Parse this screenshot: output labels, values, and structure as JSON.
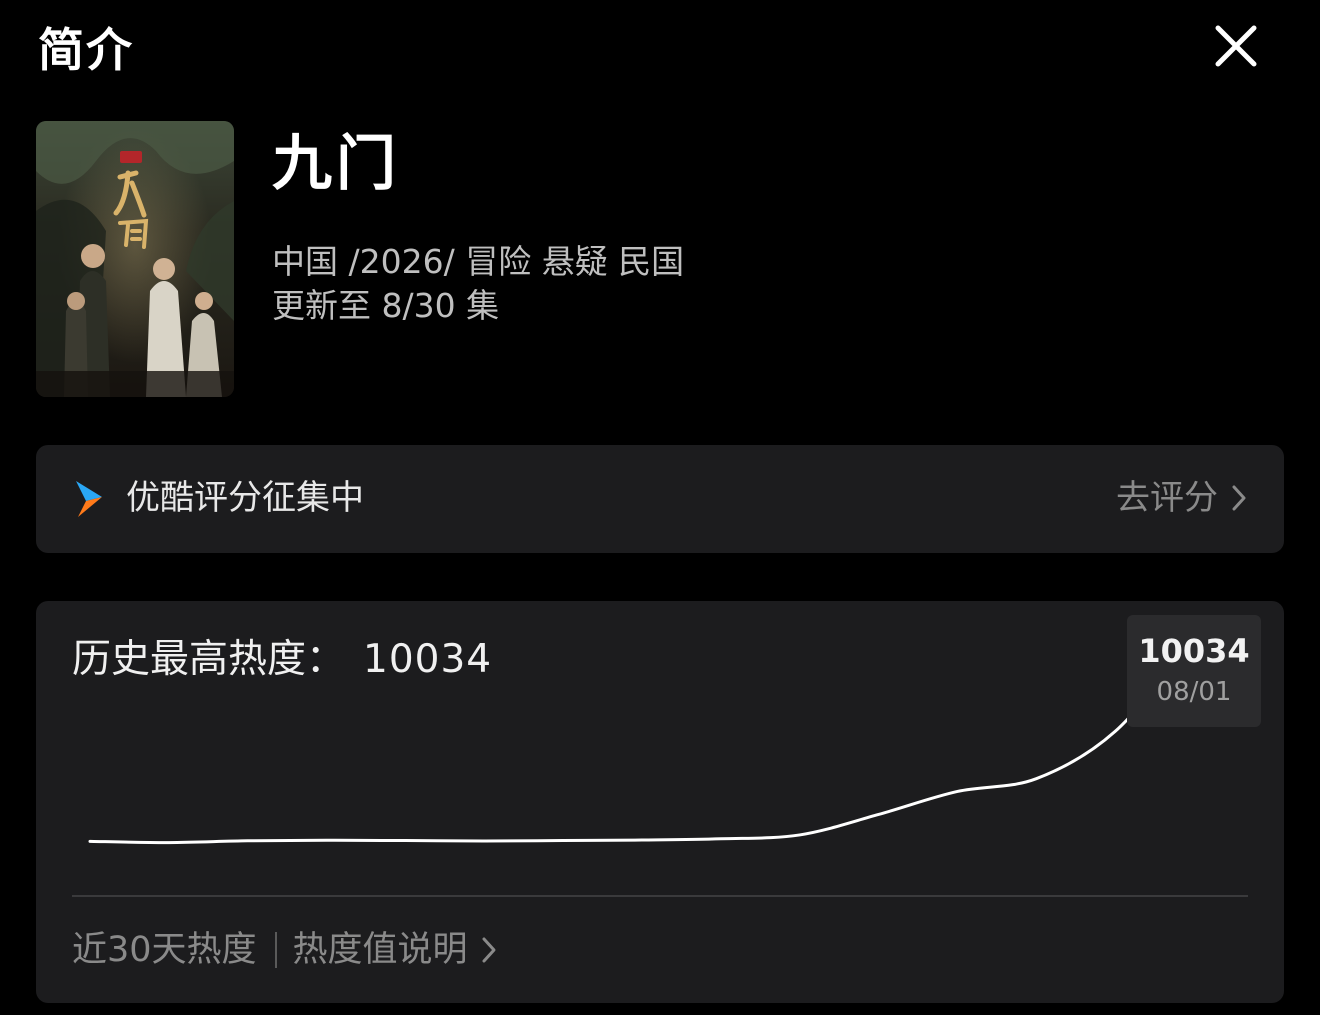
{
  "header": {
    "title": "简介"
  },
  "show": {
    "title": "九门",
    "meta_line": "中国 /2026/ 冒险  悬疑  民国",
    "episode_status": "更新至 8/30 集",
    "poster_icon": "poster-image"
  },
  "rating": {
    "label": "优酷评分征集中",
    "action": "去评分",
    "logo_icon": "youku-logo"
  },
  "heat": {
    "title": "历史最高热度：",
    "peak_value": "10034",
    "tooltip": {
      "value": "10034",
      "date": "08/01"
    },
    "range_link": "近30天热度",
    "info_link": "热度值说明"
  },
  "chart_data": {
    "type": "line",
    "title": "",
    "xlabel": "",
    "ylabel": "",
    "series": [
      {
        "values": [
          2100,
          2050,
          2120,
          2140,
          2130,
          2110,
          2130,
          2150,
          2200,
          2350,
          3150,
          4050,
          4550,
          6400,
          10034
        ]
      }
    ],
    "peak": {
      "x": "08/01",
      "y": 10034
    },
    "ylim": [
      0,
      11500
    ],
    "grid": false,
    "accent_color": "#ffffff"
  },
  "colors": {
    "background": "#000000",
    "card": "#1c1c1e",
    "muted_text": "#8a8a8a",
    "youku_blue": "#2aa7f5",
    "youku_orange": "#ff7a1a"
  }
}
